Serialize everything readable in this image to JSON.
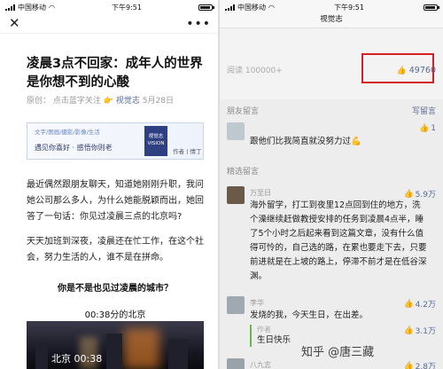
{
  "left_phone": {
    "status": {
      "carrier": "中国移动",
      "time": "下午9:51"
    },
    "article": {
      "title": "凌晨3点不回家：成年人的世界是你想不到的心酸",
      "meta_original": "原创：",
      "meta_prompt": "点击蓝字关注",
      "meta_fire": "👉",
      "meta_account": "视觉志",
      "meta_date": "5月28日",
      "banner": {
        "tags": "文字/图画/摄影/影像/生活",
        "slogan": "遇见你喜好 · 感悟你则老",
        "logo": "视觉志 VISION",
        "author": "作者丨情丁"
      },
      "para1": "最近偶然跟朋友聊天，知道她刚刚升职，我问她公司那么多人，为什么她能脱颖而出，她回答了一句话：你见过凌晨三点的北京吗?",
      "para2": "天天加班到深夜，凌晨还在忙工作，在这个社会，努力生活的人，谁不是在拼命。",
      "question": "你是不是也见过凌晨的城市？",
      "video_time": "00:38分的北京",
      "video_caption": "北京 00:38"
    }
  },
  "right_phone": {
    "status": {
      "carrier": "中国移动",
      "time": "下午9:51"
    },
    "title": "视觉志",
    "reads": "阅读 100000+",
    "likes": "49760",
    "friend_section": "朋友留言",
    "write_comment": "写留言",
    "friend_comment": {
      "name": "",
      "text": "跟他们比我简直就没努力过💪",
      "likes": "1"
    },
    "featured_section": "精选留言",
    "comments": [
      {
        "name": "万至日",
        "text": "海外留学，打工到夜里12点回到住的地方，洗个澡继续赶做教授安排的任务到凌晨4点半，睡了5个小时之后起来看到这篇文章，没有什么值得可怜的，自己选的路，在累也要走下去，只要前进就是在上坡的路上，停滞不前才是在低谷深渊。",
        "likes": "5.9万"
      },
      {
        "name": "李华",
        "text": "发烧的我，今天生日，在出差。",
        "likes": "4.2万",
        "reply": {
          "author": "作者",
          "text": "生日快乐",
          "likes": "3.1万"
        }
      },
      {
        "name": "八九志",
        "text": "",
        "likes": "2.8万"
      }
    ],
    "watermark": "知乎 @唐三藏"
  },
  "colors": {
    "link_blue": "#576b95",
    "highlight_red": "#d42020",
    "reply_bar_green": "#69b84a"
  },
  "icons": [
    "close-icon",
    "more-icon",
    "thumbs-up-icon",
    "signal-icon",
    "wifi-icon",
    "battery-icon"
  ]
}
